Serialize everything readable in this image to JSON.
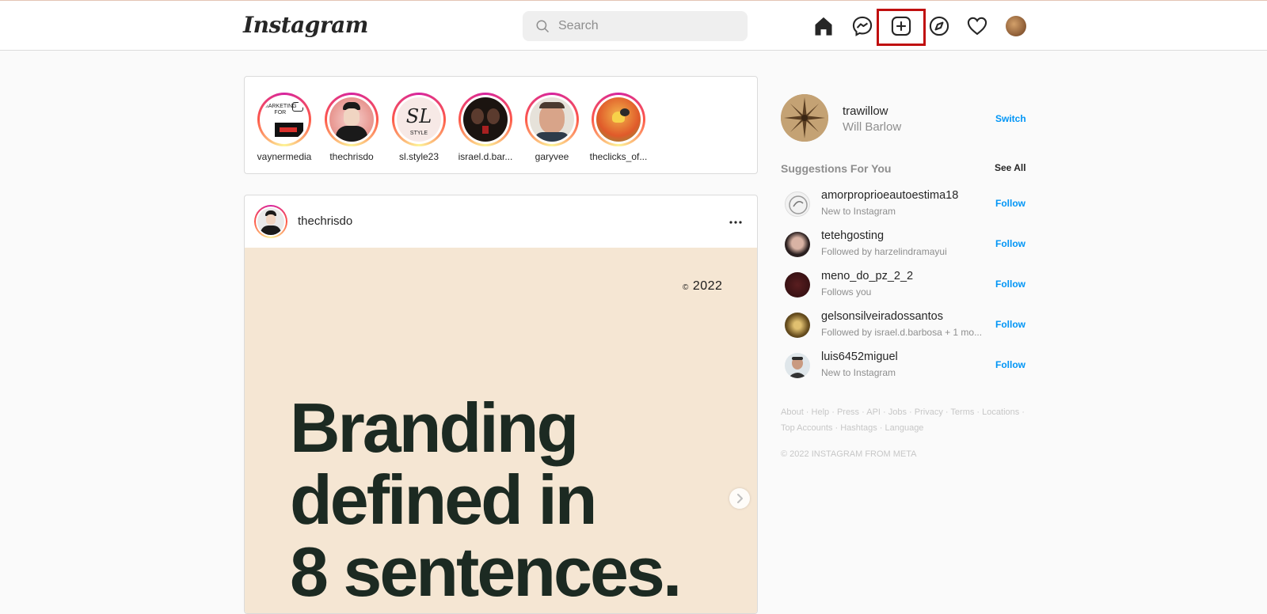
{
  "nav": {
    "logo": "Instagram",
    "search_placeholder": "Search",
    "icons": [
      "home-icon",
      "messenger-icon",
      "new-post-icon",
      "explore-icon",
      "activity-heart-icon",
      "profile-avatar"
    ]
  },
  "stories": [
    {
      "name": "vaynermedia"
    },
    {
      "name": "thechrisdo"
    },
    {
      "name": "sl.style23"
    },
    {
      "name": "israel.d.bar..."
    },
    {
      "name": "garyvee"
    },
    {
      "name": "theclicks_of..."
    }
  ],
  "post": {
    "username": "thechrisdo",
    "copyright_symbol": "©",
    "copyright_year": "2022",
    "headline_line1": "Branding",
    "headline_line2": "defined in",
    "headline_line3": "8 sentences."
  },
  "sidebar": {
    "username": "trawillow",
    "full_name": "Will Barlow",
    "switch_label": "Switch",
    "suggestions_title": "Suggestions For You",
    "see_all_label": "See All",
    "follow_label": "Follow",
    "suggestions": [
      {
        "username": "amorproprioeautoestima18",
        "subtitle": "New to Instagram"
      },
      {
        "username": "tetehgosting",
        "subtitle": "Followed by harzelindramayui"
      },
      {
        "username": "meno_do_pz_2_2",
        "subtitle": "Follows you"
      },
      {
        "username": "gelsonsilveiradossantos",
        "subtitle": "Followed by israel.d.barbosa + 1 mo..."
      },
      {
        "username": "luis6452miguel",
        "subtitle": "New to Instagram"
      }
    ],
    "footer_links": [
      "About",
      "Help",
      "Press",
      "API",
      "Jobs",
      "Privacy",
      "Terms",
      "Locations",
      "Top Accounts",
      "Hashtags",
      "Language"
    ],
    "footer_copyright": "© 2022 INSTAGRAM FROM META"
  },
  "colors": {
    "link_blue": "#0095f6",
    "highlight_red": "#c00f0f",
    "post_bg": "#f5e6d3"
  }
}
